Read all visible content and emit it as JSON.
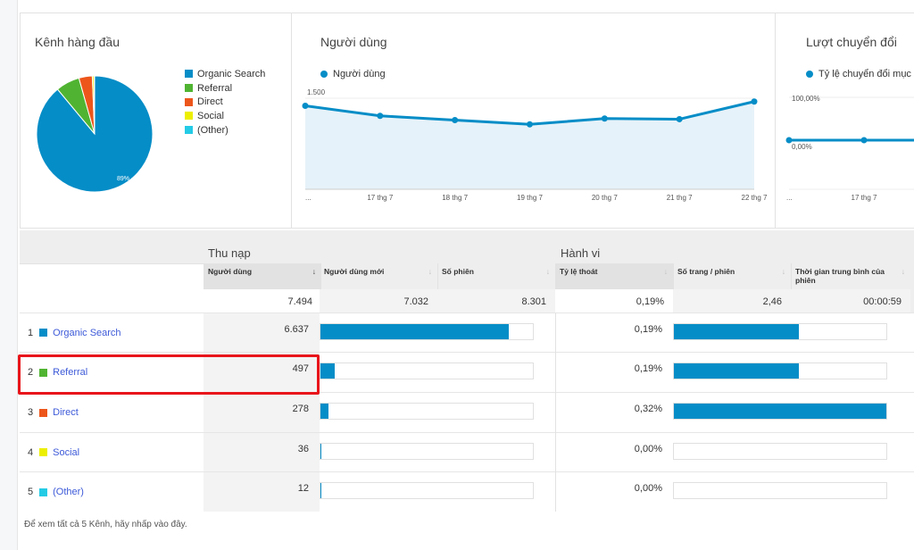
{
  "top_channels": {
    "title": "Kênh hàng đầu",
    "slice_label": "89%",
    "legend": [
      {
        "label": "Organic Search",
        "color": "#058dc7"
      },
      {
        "label": "Referral",
        "color": "#50b432"
      },
      {
        "label": "Direct",
        "color": "#ed561b"
      },
      {
        "label": "Social",
        "color": "#edef00"
      },
      {
        "label": "(Other)",
        "color": "#24cbe5"
      }
    ],
    "chart_data": {
      "type": "pie",
      "categories": [
        "Organic Search",
        "Referral",
        "Direct",
        "Social",
        "(Other)"
      ],
      "values": [
        6637,
        497,
        278,
        36,
        12
      ]
    }
  },
  "users_chart": {
    "title": "Người dùng",
    "series_label": "Người dùng",
    "chart_data": {
      "type": "area",
      "x": [
        "...",
        "17 thg 7",
        "18 thg 7",
        "19 thg 7",
        "20 thg 7",
        "21 thg 7",
        "22 thg 7"
      ],
      "y": [
        1375,
        1210,
        1140,
        1070,
        1165,
        1155,
        1445
      ],
      "yticks": [
        "500",
        "1.000",
        "1.500"
      ],
      "ytick_values": [
        500,
        1000,
        1500
      ],
      "color": "#058dc7"
    }
  },
  "conversions_chart": {
    "title": "Lượt chuyển đổi",
    "series_label": "Tỷ lệ chuyển đổi mục t",
    "chart_data": {
      "type": "line",
      "x": [
        "...",
        "17 thg 7"
      ],
      "y": [
        0,
        0
      ],
      "yticks": [
        "0,00%",
        "100,00%"
      ]
    }
  },
  "table": {
    "groups": {
      "acquisition": "Thu nạp",
      "behavior": "Hành vi"
    },
    "columns": [
      "Người dùng",
      "Người dùng mới",
      "Số phiên",
      "Tỷ lệ thoát",
      "Số trang / phiên",
      "Thời gian trung bình của phiên"
    ],
    "sort_icon": "↓",
    "totals": [
      "7.494",
      "7.032",
      "8.301",
      "0,19%",
      "2,46",
      "00:00:59"
    ],
    "rows": [
      {
        "rank": "1",
        "channel": "Organic Search",
        "color": "#058dc7",
        "users": "6.637",
        "users_share": 0.886,
        "bounce": "0,19%",
        "behavior_bar": 0.59
      },
      {
        "rank": "2",
        "channel": "Referral",
        "color": "#50b432",
        "users": "497",
        "users_share": 0.066,
        "bounce": "0,19%",
        "behavior_bar": 0.59
      },
      {
        "rank": "3",
        "channel": "Direct",
        "color": "#ed561b",
        "users": "278",
        "users_share": 0.037,
        "bounce": "0,32%",
        "behavior_bar": 1.0
      },
      {
        "rank": "4",
        "channel": "Social",
        "color": "#edef00",
        "users": "36",
        "users_share": 0.005,
        "bounce": "0,00%",
        "behavior_bar": 0.0
      },
      {
        "rank": "5",
        "channel": "(Other)",
        "color": "#24cbe5",
        "users": "12",
        "users_share": 0.002,
        "bounce": "0,00%",
        "behavior_bar": 0.0
      }
    ],
    "footer": "Để xem tất cả 5 Kênh, hãy nhấp vào đây."
  }
}
